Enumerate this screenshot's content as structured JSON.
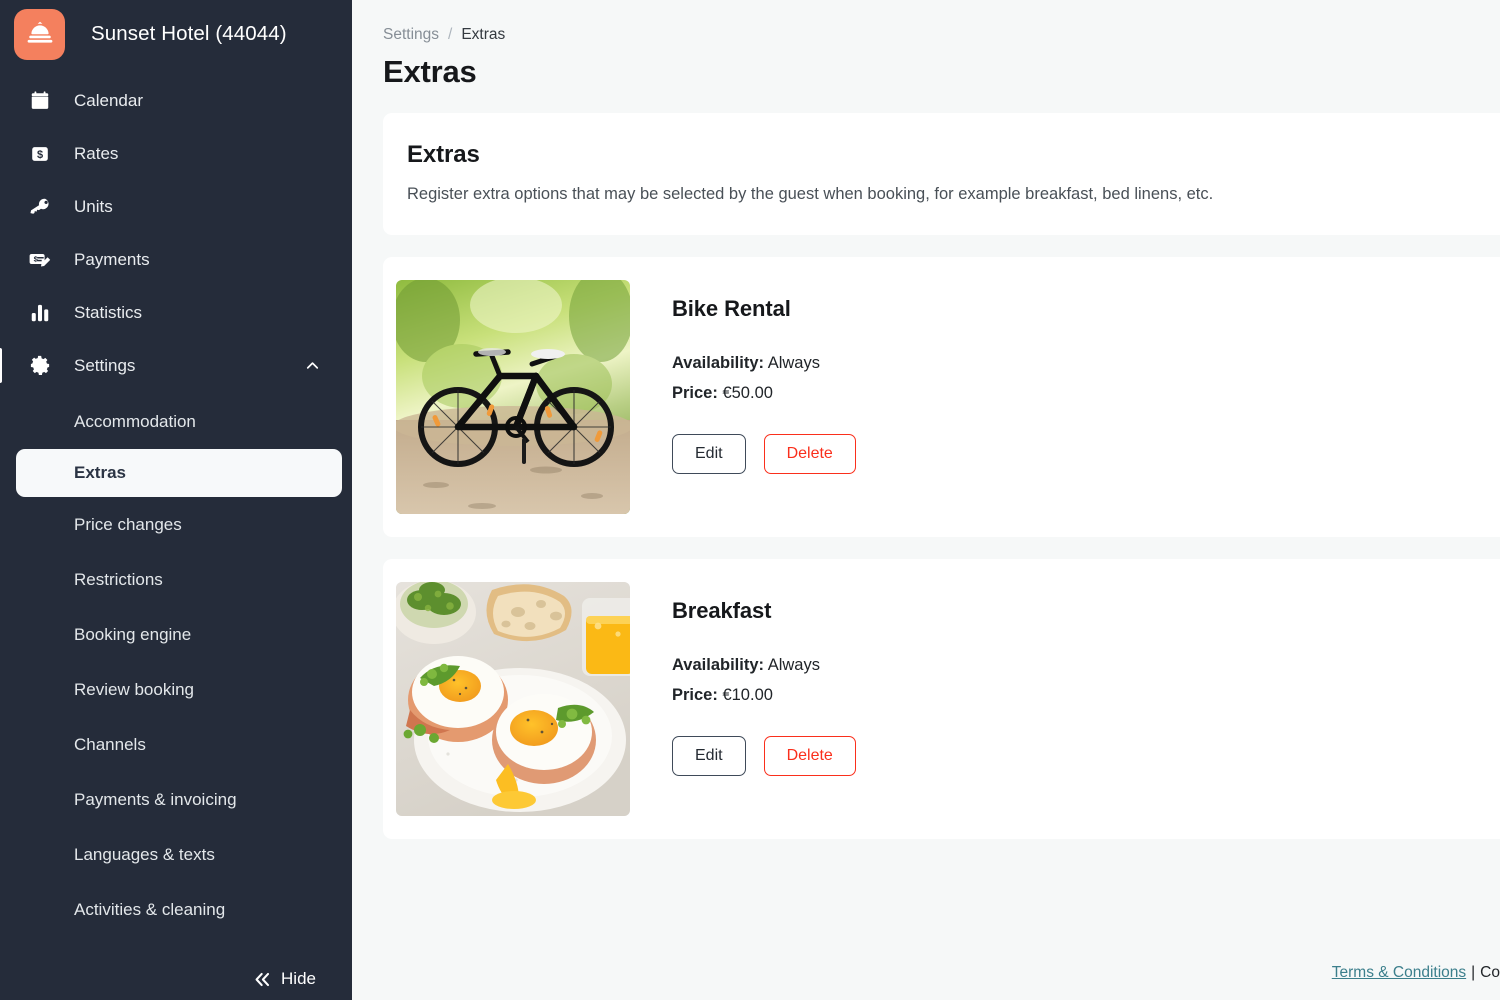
{
  "sidebar": {
    "brand": {
      "name": "Sunset Hotel (44044)",
      "logo_icon": "hotel-bell-icon",
      "logo_color": "#f4805e"
    },
    "nav": [
      {
        "label": "Calendar",
        "icon": "calendar-icon"
      },
      {
        "label": "Rates",
        "icon": "dollar-square-icon"
      },
      {
        "label": "Units",
        "icon": "key-icon"
      },
      {
        "label": "Payments",
        "icon": "payment-edit-icon"
      },
      {
        "label": "Statistics",
        "icon": "bar-chart-icon"
      },
      {
        "label": "Settings",
        "icon": "gear-icon",
        "expanded": true,
        "chevron_icon": "chevron-up-icon"
      }
    ],
    "subnav": [
      {
        "label": "Accommodation",
        "selected": false
      },
      {
        "label": "Extras",
        "selected": true
      },
      {
        "label": "Price changes",
        "selected": false
      },
      {
        "label": "Restrictions",
        "selected": false
      },
      {
        "label": "Booking engine",
        "selected": false
      },
      {
        "label": "Review booking",
        "selected": false
      },
      {
        "label": "Channels",
        "selected": false
      },
      {
        "label": "Payments & invoicing",
        "selected": false
      },
      {
        "label": "Languages & texts",
        "selected": false
      },
      {
        "label": "Activities & cleaning",
        "selected": false
      }
    ],
    "hide": {
      "label": "Hide",
      "icon": "chevron-double-left-icon"
    }
  },
  "breadcrumb": {
    "parent": "Settings",
    "separator": "/",
    "current": "Extras"
  },
  "page": {
    "title": "Extras"
  },
  "intro": {
    "heading": "Extras",
    "description": "Register extra options that may be selected by the guest when booking, for example breakfast, bed linens, etc."
  },
  "labels": {
    "availability": "Availability:",
    "price": "Price:",
    "edit": "Edit",
    "delete": "Delete"
  },
  "extras": [
    {
      "title": "Bike Rental",
      "availability": "Always",
      "price": "€50.00",
      "image": "bike-on-forest-trail-photo"
    },
    {
      "title": "Breakfast",
      "availability": "Always",
      "price": "€10.00",
      "image": "breakfast-eggs-plate-photo"
    }
  ],
  "footer": {
    "terms_link": "Terms & Conditions",
    "separator": "|",
    "trailing": "Co"
  }
}
